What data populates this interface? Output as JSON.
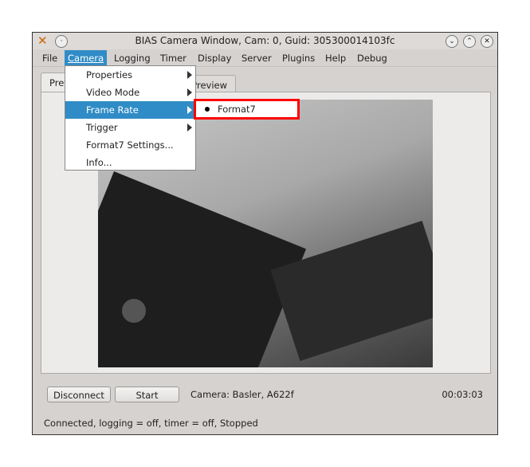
{
  "window": {
    "title": "BIAS Camera Window, Cam: 0, Guid: 305300014103fc"
  },
  "menubar": [
    {
      "label": "File"
    },
    {
      "label": "Camera"
    },
    {
      "label": "Logging"
    },
    {
      "label": "Timer"
    },
    {
      "label": "Display"
    },
    {
      "label": "Server"
    },
    {
      "label": "Plugins"
    },
    {
      "label": "Help"
    },
    {
      "label": "Debug"
    }
  ],
  "tabs": [
    {
      "label": "Preview"
    },
    {
      "label": "Preview"
    }
  ],
  "camera_menu": [
    {
      "label": "Properties",
      "submenu": true
    },
    {
      "label": "Video Mode",
      "submenu": true
    },
    {
      "label": "Frame Rate",
      "submenu": true
    },
    {
      "label": "Trigger",
      "submenu": true
    },
    {
      "label": "Format7 Settings..."
    },
    {
      "label": "Info..."
    }
  ],
  "frame_rate_submenu": [
    {
      "label": "Format7",
      "selected": true
    }
  ],
  "controls": {
    "disconnect": "Disconnect",
    "start": "Start",
    "camera_info": "Camera:  Basler,  A622f",
    "elapsed": "00:03:03"
  },
  "status": "Connected, logging = off, timer = off, Stopped",
  "colors": {
    "highlight": "#308cc6",
    "annotation": "#ff0000"
  }
}
